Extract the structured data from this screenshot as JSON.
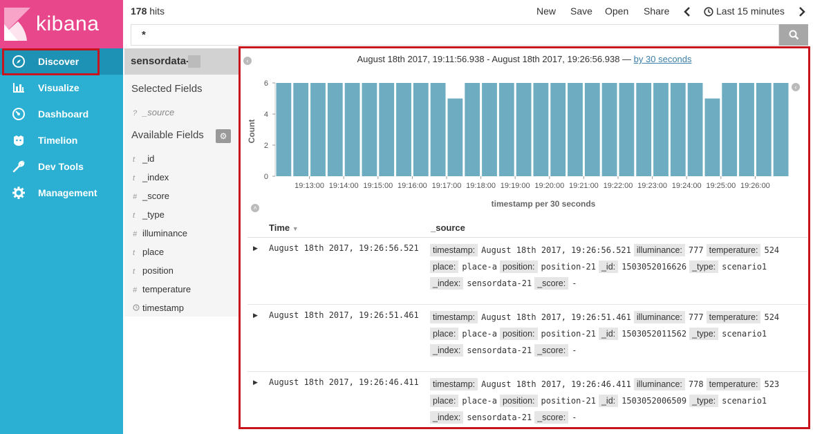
{
  "sidebar": {
    "brand": "kibana",
    "items": [
      {
        "label": "Discover",
        "icon": "compass-icon"
      },
      {
        "label": "Visualize",
        "icon": "bar-chart-icon"
      },
      {
        "label": "Dashboard",
        "icon": "dashboard-icon"
      },
      {
        "label": "Timelion",
        "icon": "timelion-icon"
      },
      {
        "label": "Dev Tools",
        "icon": "wrench-icon"
      },
      {
        "label": "Management",
        "icon": "gear-icon"
      }
    ],
    "active": "Discover"
  },
  "topbar": {
    "hits_count": "178",
    "hits_label": "hits",
    "new_label": "New",
    "save_label": "Save",
    "open_label": "Open",
    "share_label": "Share",
    "time_range_label": "Last 15 minutes"
  },
  "search": {
    "query": "*"
  },
  "fields_panel": {
    "index_pattern": "sensordata-",
    "selected_title": "Selected Fields",
    "selected": [
      {
        "type": "?",
        "name": "_source"
      }
    ],
    "available_title": "Available Fields",
    "available": [
      {
        "type": "t",
        "name": "_id"
      },
      {
        "type": "t",
        "name": "_index"
      },
      {
        "type": "#",
        "name": "_score"
      },
      {
        "type": "t",
        "name": "_type"
      },
      {
        "type": "#",
        "name": "illuminance"
      },
      {
        "type": "t",
        "name": "place"
      },
      {
        "type": "t",
        "name": "position"
      },
      {
        "type": "#",
        "name": "temperature"
      },
      {
        "type": "clock",
        "name": "timestamp"
      }
    ]
  },
  "histogram": {
    "range_text": "August 18th 2017, 19:11:56.938 - August 18th 2017, 19:26:56.938 —",
    "interval_link": "by 30 seconds"
  },
  "chart_data": {
    "type": "bar",
    "title": "",
    "xlabel": "timestamp per 30 seconds",
    "ylabel": "Count",
    "ylim": [
      0,
      6
    ],
    "yticks": [
      0,
      2,
      4,
      6
    ],
    "xticks": [
      "19:13:00",
      "19:14:00",
      "19:15:00",
      "19:16:00",
      "19:17:00",
      "19:18:00",
      "19:19:00",
      "19:20:00",
      "19:21:00",
      "19:22:00",
      "19:23:00",
      "19:24:00",
      "19:25:00",
      "19:26:00"
    ],
    "values": [
      6,
      6,
      6,
      6,
      6,
      6,
      6,
      6,
      6,
      6,
      5,
      6,
      6,
      6,
      6,
      6,
      6,
      6,
      6,
      6,
      6,
      6,
      6,
      6,
      6,
      5,
      6,
      6,
      6,
      6
    ],
    "color": "#6eadc1",
    "grid": false
  },
  "table": {
    "time_header": "Time",
    "source_header": "_source",
    "rows": [
      {
        "time": "August 18th 2017, 19:26:56.521",
        "line1": [
          [
            "timestamp:",
            "August 18th 2017, 19:26:56.521"
          ],
          [
            "illuminance:",
            "777"
          ],
          [
            "temperature:",
            "524"
          ]
        ],
        "line2": [
          [
            "place:",
            "place-a"
          ],
          [
            "position:",
            "position-21"
          ],
          [
            "_id:",
            "1503052016626"
          ],
          [
            "_type:",
            "scenario1"
          ]
        ],
        "line3": [
          [
            "_index:",
            "sensordata-21"
          ],
          [
            "_score:",
            "-"
          ]
        ]
      },
      {
        "time": "August 18th 2017, 19:26:51.461",
        "line1": [
          [
            "timestamp:",
            "August 18th 2017, 19:26:51.461"
          ],
          [
            "illuminance:",
            "777"
          ],
          [
            "temperature:",
            "524"
          ]
        ],
        "line2": [
          [
            "place:",
            "place-a"
          ],
          [
            "position:",
            "position-21"
          ],
          [
            "_id:",
            "1503052011562"
          ],
          [
            "_type:",
            "scenario1"
          ]
        ],
        "line3": [
          [
            "_index:",
            "sensordata-21"
          ],
          [
            "_score:",
            "-"
          ]
        ]
      },
      {
        "time": "August 18th 2017, 19:26:46.411",
        "line1": [
          [
            "timestamp:",
            "August 18th 2017, 19:26:46.411"
          ],
          [
            "illuminance:",
            "778"
          ],
          [
            "temperature:",
            "523"
          ]
        ],
        "line2": [
          [
            "place:",
            "place-a"
          ],
          [
            "position:",
            "position-21"
          ],
          [
            "_id:",
            "1503052006509"
          ],
          [
            "_type:",
            "scenario1"
          ]
        ],
        "line3": [
          [
            "_index:",
            "sensordata-21"
          ],
          [
            "_score:",
            "-"
          ]
        ]
      }
    ]
  }
}
